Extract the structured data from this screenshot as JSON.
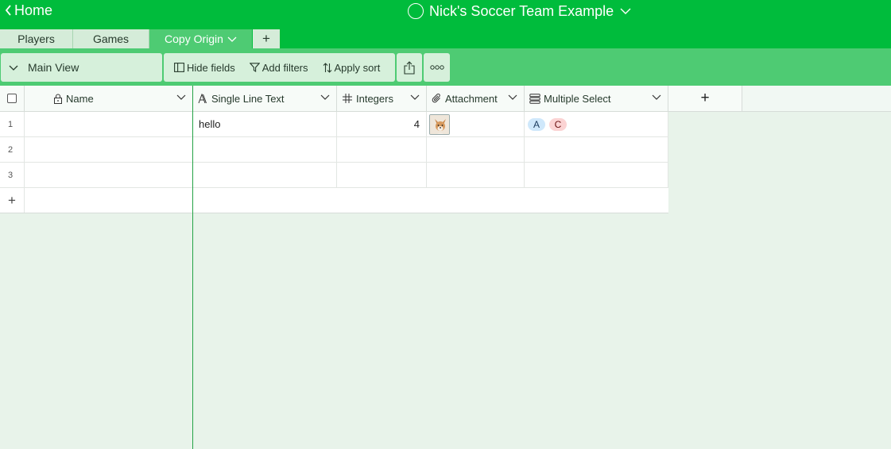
{
  "header": {
    "back_label": "Home",
    "base_title": "Nick's Soccer Team Example"
  },
  "tabs": [
    {
      "label": "Players",
      "active": false
    },
    {
      "label": "Games",
      "active": false
    },
    {
      "label": "Copy Origin",
      "active": true
    }
  ],
  "tab_add_label": "+",
  "toolbar": {
    "view_name": "Main View",
    "hide_fields_label": "Hide fields",
    "add_filters_label": "Add filters",
    "apply_sort_label": "Apply sort"
  },
  "columns": [
    {
      "name": "Name",
      "icon": "lock-icon"
    },
    {
      "name": "Single Line Text",
      "icon": "text-type-icon"
    },
    {
      "name": "Integers",
      "icon": "hash-icon"
    },
    {
      "name": "Attachment",
      "icon": "paperclip-icon"
    },
    {
      "name": "Multiple Select",
      "icon": "multi-select-icon"
    }
  ],
  "add_column_label": "+",
  "rows": [
    {
      "num": "1",
      "name": "",
      "single_line_text": "hello",
      "integers": "4",
      "attachment": "dog-photo-thumbnail",
      "multiple_select": [
        {
          "label": "A",
          "bg": "#cfe8fb",
          "fg": "#1a3a5c"
        },
        {
          "label": "C",
          "bg": "#fbd3d3",
          "fg": "#6b1010"
        }
      ]
    },
    {
      "num": "2",
      "name": "",
      "single_line_text": "",
      "integers": "",
      "attachment": "",
      "multiple_select": []
    },
    {
      "num": "3",
      "name": "",
      "single_line_text": "",
      "integers": "",
      "attachment": "",
      "multiple_select": []
    }
  ],
  "add_row_label": "+",
  "colors": {
    "topbar": "#00bc3c",
    "toolbar": "#4ecb73",
    "canvas": "#e8f3ea",
    "frozen_divider": "#25a346"
  }
}
